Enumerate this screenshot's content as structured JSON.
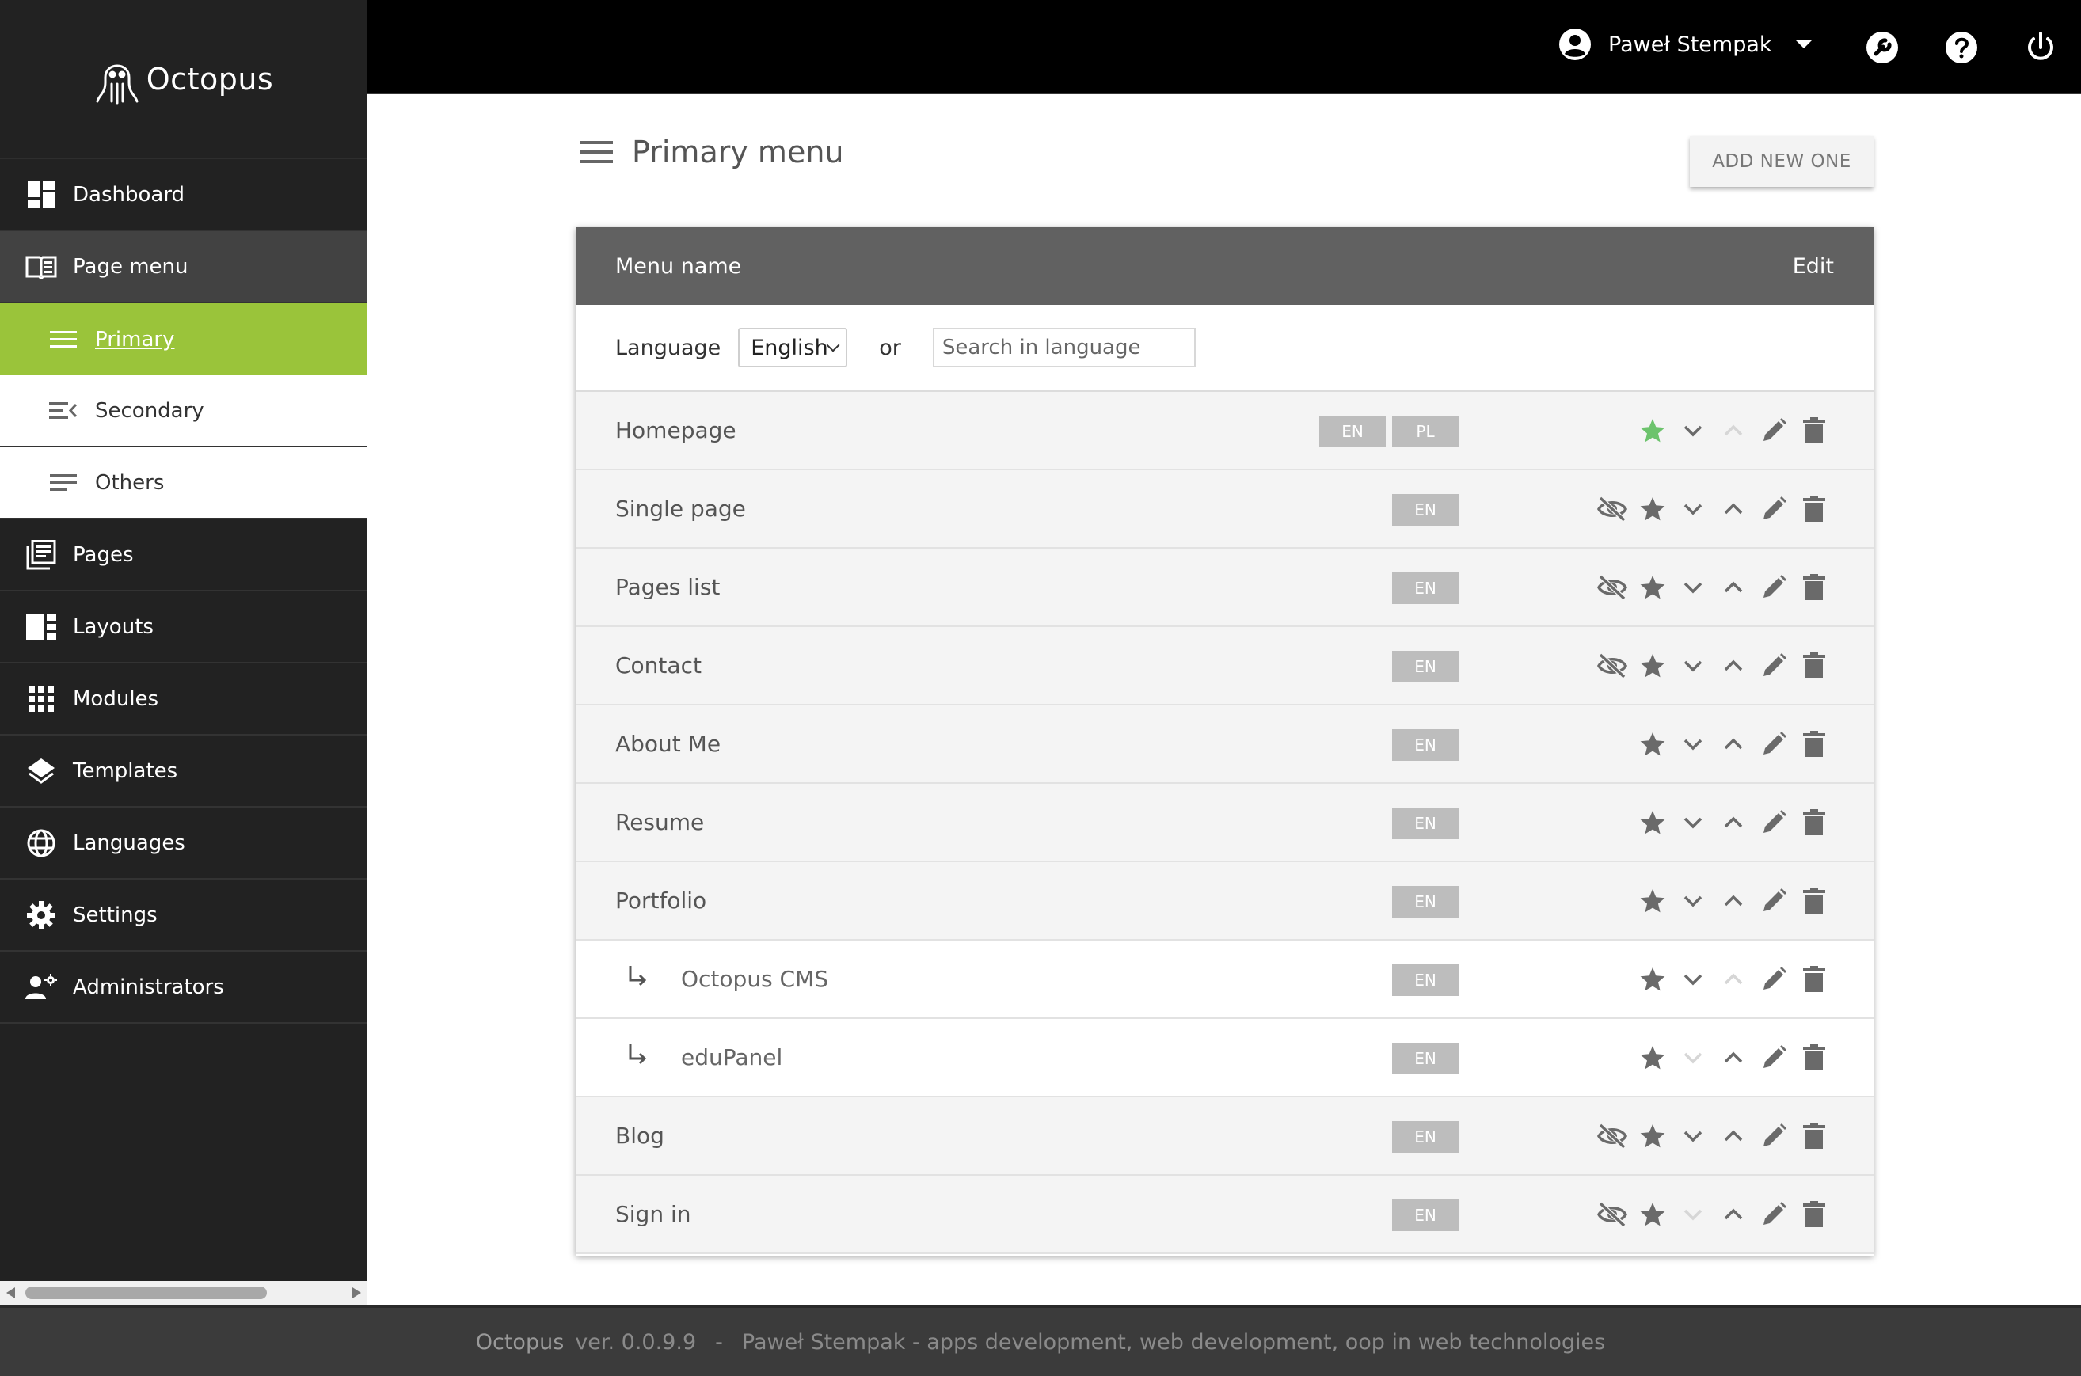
{
  "app": {
    "name": "Octopus"
  },
  "sidebar": {
    "items": [
      {
        "label": "Dashboard",
        "icon": "dashboard-icon"
      },
      {
        "label": "Page menu",
        "icon": "book-icon"
      },
      {
        "label": "Pages",
        "icon": "pages-icon"
      },
      {
        "label": "Layouts",
        "icon": "layout-icon"
      },
      {
        "label": "Modules",
        "icon": "grid-icon"
      },
      {
        "label": "Templates",
        "icon": "layers-icon"
      },
      {
        "label": "Languages",
        "icon": "globe-icon"
      },
      {
        "label": "Settings",
        "icon": "gear-icon"
      },
      {
        "label": "Administrators",
        "icon": "admins-icon"
      }
    ],
    "submenu": [
      {
        "label": "Primary",
        "active": true
      },
      {
        "label": "Secondary",
        "active": false
      },
      {
        "label": "Others",
        "active": false
      }
    ]
  },
  "topbar": {
    "user_name": "Paweł Stempak"
  },
  "page": {
    "title": "Primary menu",
    "add_button": "ADD NEW ONE"
  },
  "table": {
    "col_name": "Menu name",
    "col_edit": "Edit",
    "filter": {
      "language_label": "Language",
      "language_value": "English",
      "or_text": "or",
      "search_placeholder": "Search in language"
    },
    "rows": [
      {
        "name": "Homepage",
        "badges": [
          "EN",
          "PL"
        ],
        "starred": true,
        "hidden": false,
        "can_down": true,
        "can_up": false,
        "child": false
      },
      {
        "name": "Single page",
        "badges": [
          "EN"
        ],
        "starred": false,
        "hidden": true,
        "can_down": true,
        "can_up": true,
        "child": false
      },
      {
        "name": "Pages list",
        "badges": [
          "EN"
        ],
        "starred": false,
        "hidden": true,
        "can_down": true,
        "can_up": true,
        "child": false
      },
      {
        "name": "Contact",
        "badges": [
          "EN"
        ],
        "starred": false,
        "hidden": true,
        "can_down": true,
        "can_up": true,
        "child": false
      },
      {
        "name": "About Me",
        "badges": [
          "EN"
        ],
        "starred": false,
        "hidden": false,
        "can_down": true,
        "can_up": true,
        "child": false
      },
      {
        "name": "Resume",
        "badges": [
          "EN"
        ],
        "starred": false,
        "hidden": false,
        "can_down": true,
        "can_up": true,
        "child": false
      },
      {
        "name": "Portfolio",
        "badges": [
          "EN"
        ],
        "starred": false,
        "hidden": false,
        "can_down": true,
        "can_up": true,
        "child": false
      },
      {
        "name": "Octopus CMS",
        "badges": [
          "EN"
        ],
        "starred": false,
        "hidden": false,
        "can_down": true,
        "can_up": false,
        "child": true
      },
      {
        "name": "eduPanel",
        "badges": [
          "EN"
        ],
        "starred": false,
        "hidden": false,
        "can_down": false,
        "can_up": true,
        "child": true
      },
      {
        "name": "Blog",
        "badges": [
          "EN"
        ],
        "starred": false,
        "hidden": true,
        "can_down": true,
        "can_up": true,
        "child": false
      },
      {
        "name": "Sign in",
        "badges": [
          "EN"
        ],
        "starred": false,
        "hidden": true,
        "can_down": false,
        "can_up": true,
        "child": false
      }
    ]
  },
  "footer": {
    "brand": "Octopus",
    "version": "ver. 0.0.9.9",
    "separator": "-",
    "credits": "Paweł Stempak - apps development, web development, oop in web technologies"
  },
  "colors": {
    "accent": "#9ac43a",
    "star_active": "#6cc36c",
    "sidebar_bg": "#222222",
    "topbar_bg": "#000000",
    "table_head_bg": "#616161",
    "badge_bg": "#bdbdbd"
  }
}
